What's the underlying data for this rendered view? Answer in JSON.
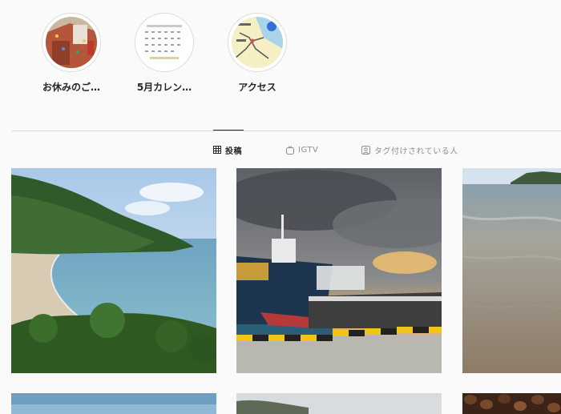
{
  "highlights": [
    {
      "label": "お休みのご…",
      "icon": "climbing-wall-thumbnail"
    },
    {
      "label": "5月カレン…",
      "icon": "calendar-thumbnail"
    },
    {
      "label": "アクセス",
      "icon": "map-thumbnail"
    }
  ],
  "tabs": [
    {
      "label": "投稿",
      "icon": "grid-icon",
      "active": true
    },
    {
      "label": "IGTV",
      "icon": "igtv-icon",
      "active": false
    },
    {
      "label": "タグ付けされている人",
      "icon": "tagged-icon",
      "active": false
    }
  ],
  "posts": [
    {
      "subject": "coastal-bay-photo"
    },
    {
      "subject": "harbor-ship-sunset-photo"
    },
    {
      "subject": "sandy-shore-photo"
    },
    {
      "subject": "sea-sky-photo"
    },
    {
      "subject": "hill-photo"
    },
    {
      "subject": "coffee-beans-photo"
    }
  ],
  "colors": {
    "accent": "#262626",
    "muted": "#8e8e8e",
    "border": "#dbdbdb",
    "background": "#fafafa"
  }
}
